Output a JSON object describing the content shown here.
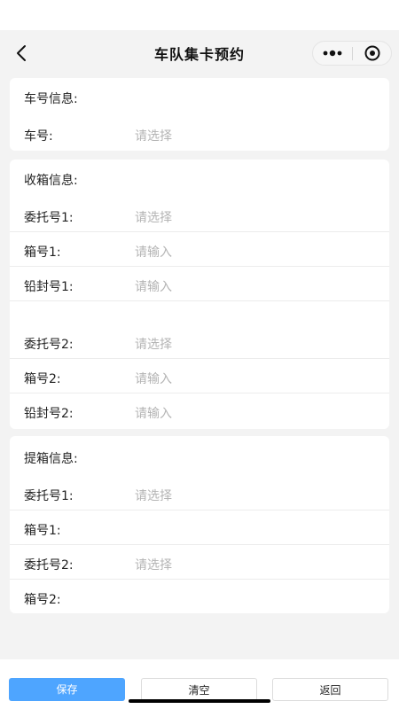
{
  "nav": {
    "title": "车队集卡预约"
  },
  "icons": {
    "back": "chevron-left-icon",
    "more": "more-dots-icon",
    "close": "target-circle-icon"
  },
  "sections": {
    "truck": {
      "title": "车号信息:",
      "fields": [
        {
          "label": "车号:",
          "placeholder": "请选择"
        }
      ]
    },
    "receive": {
      "title": "收箱信息:",
      "group1": [
        {
          "label": "委托号1:",
          "placeholder": "请选择"
        },
        {
          "label": "箱号1:",
          "placeholder": "请输入"
        },
        {
          "label": "铅封号1:",
          "placeholder": "请输入"
        }
      ],
      "group2": [
        {
          "label": "委托号2:",
          "placeholder": "请选择"
        },
        {
          "label": "箱号2:",
          "placeholder": "请输入"
        },
        {
          "label": "铅封号2:",
          "placeholder": "请输入"
        }
      ]
    },
    "pickup": {
      "title": "提箱信息:",
      "fields": [
        {
          "label": "委托号1:",
          "placeholder": "请选择"
        },
        {
          "label": "箱号1:",
          "placeholder": ""
        },
        {
          "label": "委托号2:",
          "placeholder": "请选择"
        },
        {
          "label": "箱号2:",
          "placeholder": ""
        }
      ]
    }
  },
  "footer": {
    "save_label": "保存",
    "clear_label": "清空",
    "back_label": "返回"
  },
  "colors": {
    "primary": "#4ea5ff",
    "background": "#f3f3f3",
    "placeholder": "#b4b4b4"
  }
}
